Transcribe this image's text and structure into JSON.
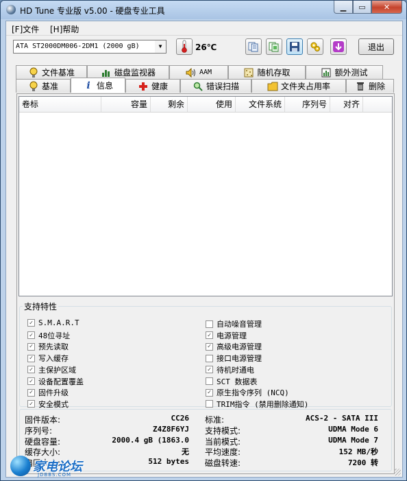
{
  "window": {
    "title": "HD Tune 专业版 v5.00 - 硬盘专业工具",
    "min_label": "▁",
    "max_label": "▭",
    "close_label": "✕"
  },
  "menu": {
    "file": "[F]文件",
    "help": "[H]帮助"
  },
  "toolbar": {
    "drive": "ATA    ST2000DM006-2DM1 (2000 gB)",
    "temperature": "26℃",
    "exit_label": "退出"
  },
  "tabs": {
    "row1": [
      "文件基准",
      "磁盘监视器",
      "AAM",
      "随机存取",
      "额外测试"
    ],
    "row2": [
      "基准",
      "信息",
      "健康",
      "错误扫描",
      "文件夹占用率",
      "删除"
    ],
    "active": "信息"
  },
  "volumes": {
    "columns": [
      "卷标",
      "容量",
      "剩余",
      "使用",
      "文件系统",
      "序列号",
      "对齐"
    ],
    "rows": []
  },
  "features": {
    "title": "支持特性",
    "left": [
      {
        "label": "S.M.A.R.T",
        "checked": true
      },
      {
        "label": "48位寻址",
        "checked": true
      },
      {
        "label": "预先读取",
        "checked": true
      },
      {
        "label": "写入缓存",
        "checked": true
      },
      {
        "label": "主保护区域",
        "checked": true
      },
      {
        "label": "设备配置覆盖",
        "checked": true
      },
      {
        "label": "固件升级",
        "checked": true
      },
      {
        "label": "安全模式",
        "checked": true
      }
    ],
    "right": [
      {
        "label": "自动噪音管理",
        "checked": false
      },
      {
        "label": "电源管理",
        "checked": true
      },
      {
        "label": "高级电源管理",
        "checked": true
      },
      {
        "label": "接口电源管理",
        "checked": false
      },
      {
        "label": "待机时通电",
        "checked": true
      },
      {
        "label": "SCT 数据表",
        "checked": false
      },
      {
        "label": "原生指令序列 (NCQ)",
        "checked": true
      },
      {
        "label": "TRIM指令 (禁用删除通知)",
        "checked": false
      }
    ]
  },
  "info": {
    "left": [
      {
        "label": "固件版本:",
        "value": "CC26"
      },
      {
        "label": "序列号:",
        "value": "Z4Z8F6YJ"
      },
      {
        "label": "硬盘容量:",
        "value": "2000.4 gB (1863.0"
      },
      {
        "label": "缓存大小:",
        "value": "无"
      },
      {
        "label": "扇区大小:",
        "value": "512 bytes"
      }
    ],
    "right": [
      {
        "label": "标准:",
        "value": "ACS-2 - SATA III"
      },
      {
        "label": "支持模式:",
        "value": "UDMA Mode 6"
      },
      {
        "label": "当前模式:",
        "value": "UDMA Mode 7"
      },
      {
        "label": "平均速度:",
        "value": "152 MB/秒"
      },
      {
        "label": "磁盘转速:",
        "value": "7200 转"
      }
    ]
  },
  "watermark": {
    "text": "家电论坛",
    "sub": "JDBBS.COM"
  }
}
